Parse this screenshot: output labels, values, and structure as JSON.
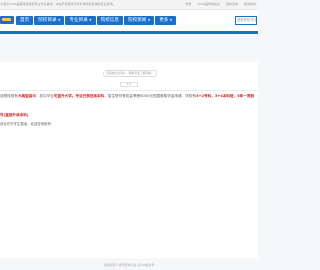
{
  "topbar": {
    "notice": "为满足2026届报考院校和专业学生需求，本站开通留学生专升本院校查询和专业查询。",
    "links": [
      "登录",
      "2026届学院信息",
      "院校查询",
      "报考指导"
    ]
  },
  "header": {
    "nav": [
      {
        "label": "首页",
        "dropdown": false
      },
      {
        "label": "院校目录",
        "dropdown": true
      },
      {
        "label": "专业目录",
        "dropdown": true
      },
      {
        "label": "院校信息",
        "dropdown": false
      },
      {
        "label": "院校新闻",
        "dropdown": true
      },
      {
        "label": "更多",
        "dropdown": true
      }
    ],
    "search_placeholder": "搜索院校/专业"
  },
  "article": {
    "summary": "该院校信息简介，帮助考生了解院校。",
    "page": "1/1",
    "para_a": "该院校现有",
    "para_b": "大典型高中",
    "para_c": "，初中毕业",
    "para_d": "可直升大学。专业已获批准本科",
    "para_e": "，招生院可有机会享受6000元的国家助学金申请，学校有",
    "para_f": "3+2专科，3+4本科班，5年一贯制",
    "red_line": "可(直接升读本科)",
    "plain_line": "适合在外学生报读，欢迎咨询报考。"
  },
  "footer": {
    "text": "版权所有©学历查询平台  京ICP备案号"
  },
  "colors": {
    "brand": "#1a6fc9",
    "highlight": "#e02020"
  }
}
